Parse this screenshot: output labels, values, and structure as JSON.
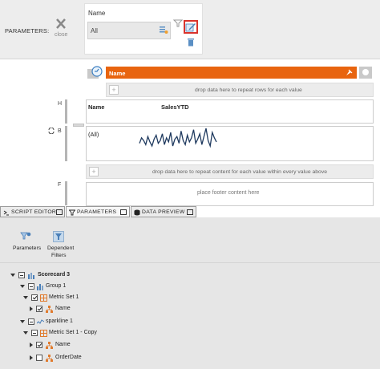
{
  "parameters_bar": {
    "title": "PARAMETERS:",
    "close_label": "close",
    "parameter": {
      "name": "Name",
      "value": "All"
    }
  },
  "designer": {
    "header_band_title": "Name",
    "rows_drop_text": "drop data here to repeat rows for each value",
    "band_letters": {
      "header": "H",
      "body": "B",
      "footer": "F"
    },
    "columns": [
      "Name",
      "SalesYTD"
    ],
    "row_value": "(All)",
    "content_drop_text": "drop data here to repeat content for each value within every value above",
    "footer_placeholder": "place footer content here",
    "plus_glyph": "+"
  },
  "sparkline_values": [
    4,
    8,
    6,
    3,
    9,
    5,
    2,
    7,
    10,
    4,
    6,
    11,
    3,
    8,
    5,
    12,
    2,
    7,
    9,
    4,
    13,
    6,
    3,
    10,
    5,
    8,
    14,
    4,
    7,
    11,
    3,
    9,
    15,
    6,
    2,
    12,
    8,
    5
  ],
  "tabs": [
    {
      "label": "SCRIPT EDITOR",
      "icon": "terminal-icon"
    },
    {
      "label": "PARAMETERS",
      "icon": "funnel-icon"
    },
    {
      "label": "DATA PREVIEW",
      "icon": "database-icon"
    }
  ],
  "toolbar": {
    "parameters_label": "Parameters",
    "dependent_filters_label": [
      "Dependent",
      "Filters"
    ]
  },
  "tree": [
    {
      "label": "Scorecard 3",
      "bold": true
    },
    {
      "label": "Group 1"
    },
    {
      "label": "Metric Set 1"
    },
    {
      "label": "Name"
    },
    {
      "label": "sparkline 1"
    },
    {
      "label": "Metric Set 1 - Copy"
    },
    {
      "label": "Name"
    },
    {
      "label": "OrderDate"
    }
  ],
  "colors": {
    "accent_orange": "#e8640f",
    "highlight_red": "#d9332d",
    "sparkline": "#1f3a5f",
    "field_orange": "#e07a2c"
  }
}
